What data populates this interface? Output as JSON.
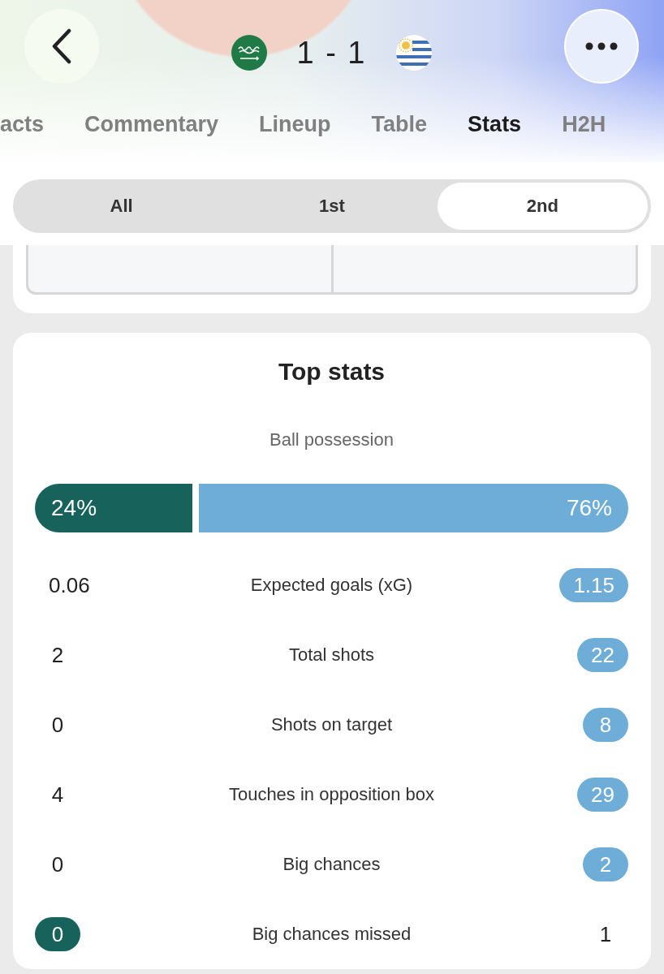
{
  "header": {
    "score": "1 - 1"
  },
  "tabs": [
    {
      "label": "acts",
      "selected": false
    },
    {
      "label": "Commentary",
      "selected": false
    },
    {
      "label": "Lineup",
      "selected": false
    },
    {
      "label": "Table",
      "selected": false
    },
    {
      "label": "Stats",
      "selected": true
    },
    {
      "label": "H2H",
      "selected": false
    }
  ],
  "periods": [
    {
      "label": "All",
      "selected": false
    },
    {
      "label": "1st",
      "selected": false
    },
    {
      "label": "2nd",
      "selected": true
    }
  ],
  "top_stats": {
    "title": "Top stats",
    "possession": {
      "label": "Ball possession",
      "home": {
        "value": "24%",
        "level": 0.24
      },
      "away": {
        "value": "76%",
        "level": 0.76
      }
    },
    "rows": [
      {
        "label": "Expected goals (xG)",
        "home": {
          "value": "0.06",
          "highlighted": false
        },
        "away": {
          "value": "1.15",
          "highlighted": true
        }
      },
      {
        "label": "Total shots",
        "home": {
          "value": "2",
          "highlighted": false
        },
        "away": {
          "value": "22",
          "highlighted": true
        }
      },
      {
        "label": "Shots on target",
        "home": {
          "value": "0",
          "highlighted": false
        },
        "away": {
          "value": "8",
          "highlighted": true
        }
      },
      {
        "label": "Touches in opposition box",
        "home": {
          "value": "4",
          "highlighted": false
        },
        "away": {
          "value": "29",
          "highlighted": true
        }
      },
      {
        "label": "Big chances",
        "home": {
          "value": "0",
          "highlighted": false
        },
        "away": {
          "value": "2",
          "highlighted": true
        }
      },
      {
        "label": "Big chances missed",
        "home": {
          "value": "0",
          "highlighted": true
        },
        "away": {
          "value": "1",
          "highlighted": false
        }
      }
    ]
  }
}
